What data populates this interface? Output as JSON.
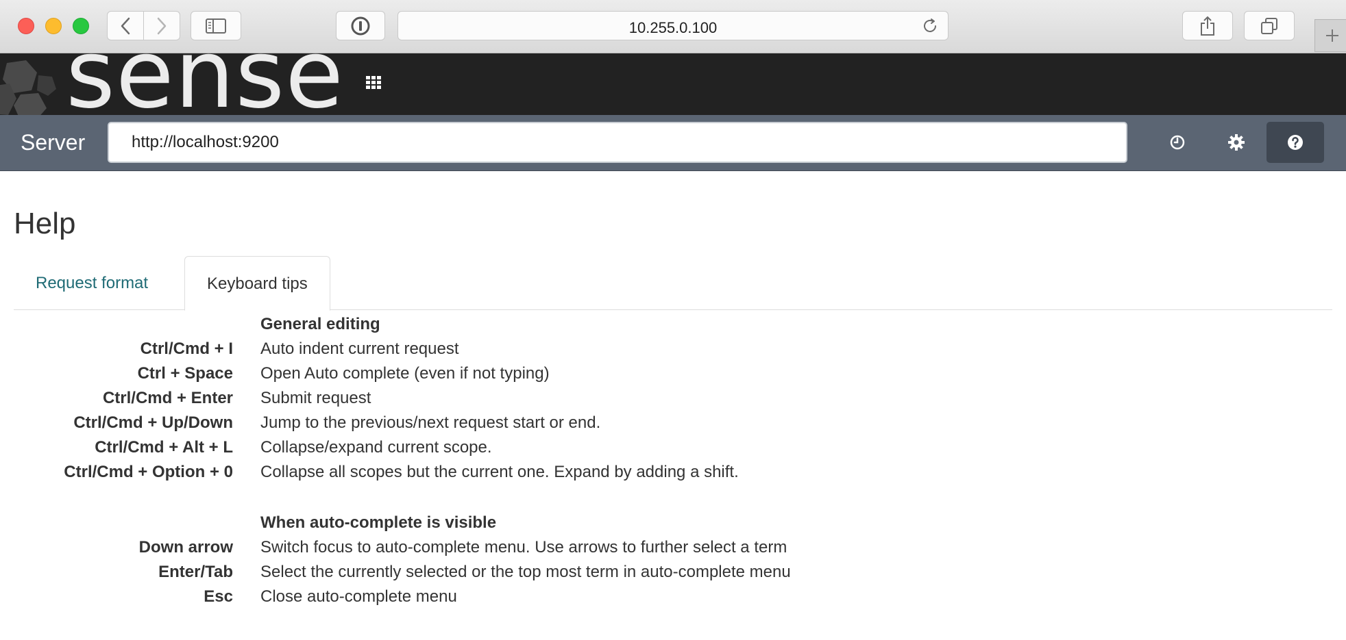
{
  "browser": {
    "url": "10.255.0.100"
  },
  "app": {
    "logo_text": "sense"
  },
  "server": {
    "label": "Server",
    "url_value": "http://localhost:9200"
  },
  "help": {
    "title": "Help",
    "tabs": [
      {
        "label": "Request format",
        "active": false
      },
      {
        "label": "Keyboard tips",
        "active": true
      }
    ],
    "sections": [
      {
        "heading": "General editing",
        "tips": [
          {
            "key": "Ctrl/Cmd + I",
            "desc": "Auto indent current request"
          },
          {
            "key": "Ctrl + Space",
            "desc": "Open Auto complete (even if not typing)"
          },
          {
            "key": "Ctrl/Cmd + Enter",
            "desc": "Submit request"
          },
          {
            "key": "Ctrl/Cmd + Up/Down",
            "desc": "Jump to the previous/next request start or end."
          },
          {
            "key": "Ctrl/Cmd + Alt + L",
            "desc": "Collapse/expand current scope."
          },
          {
            "key": "Ctrl/Cmd + Option + 0",
            "desc": "Collapse all scopes but the current one. Expand by adding a shift."
          }
        ]
      },
      {
        "heading": "When auto-complete is visible",
        "tips": [
          {
            "key": "Down arrow",
            "desc": "Switch focus to auto-complete menu. Use arrows to further select a term"
          },
          {
            "key": "Enter/Tab",
            "desc": "Select the currently selected or the top most term in auto-complete menu"
          },
          {
            "key": "Esc",
            "desc": "Close auto-complete menu"
          }
        ]
      }
    ]
  },
  "colors": {
    "header_bg": "#222222",
    "server_bar_bg": "#5b6573",
    "tab_link": "#1f6b75",
    "active_icon_bg": "#3f4752"
  },
  "icons": {
    "back": "chevron-left-icon",
    "forward": "chevron-right-icon",
    "sidebar": "sidebar-icon",
    "privacy": "privacy-icon",
    "reload": "reload-icon",
    "share": "share-icon",
    "tabs": "tabs-overview-icon",
    "new_tab": "plus-icon",
    "apps": "apps-grid-icon",
    "history": "clock-icon",
    "settings": "gear-icon",
    "help": "question-icon"
  }
}
